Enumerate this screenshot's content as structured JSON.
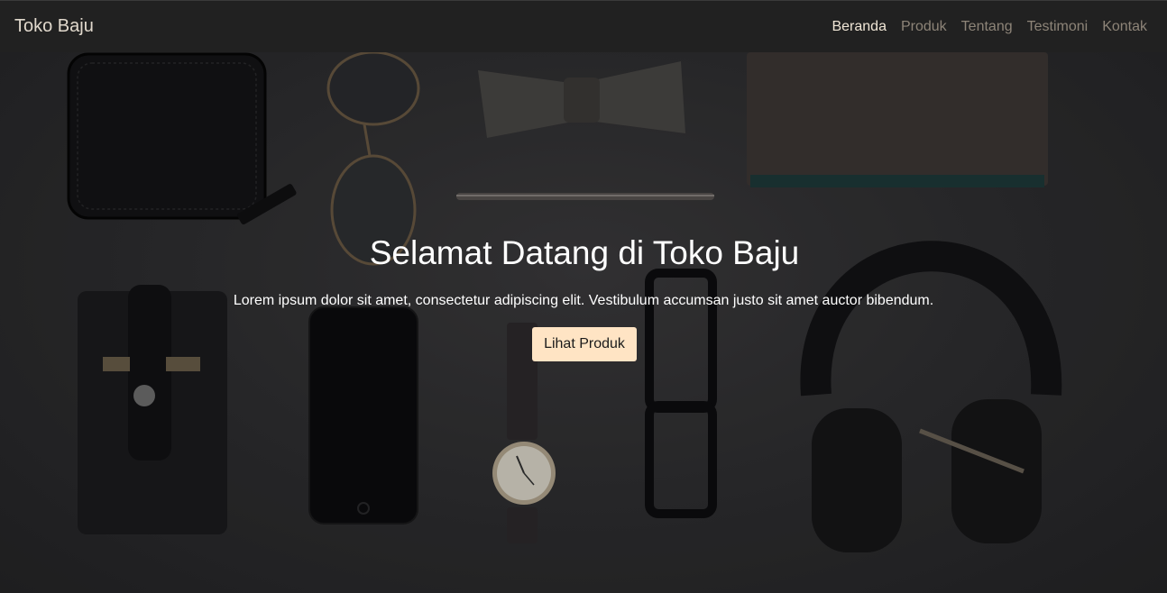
{
  "navbar": {
    "brand": "Toko Baju",
    "links": [
      {
        "label": "Beranda",
        "active": true
      },
      {
        "label": "Produk",
        "active": false
      },
      {
        "label": "Tentang",
        "active": false
      },
      {
        "label": "Testimoni",
        "active": false
      },
      {
        "label": "Kontak",
        "active": false
      }
    ]
  },
  "hero": {
    "title": "Selamat Datang di Toko Baju",
    "subtitle": "Lorem ipsum dolor sit amet, consectetur adipiscing elit. Vestibulum accumsan justo sit amet auctor bibendum.",
    "button_label": "Lihat Produk"
  },
  "colors": {
    "navbar_bg": "#212121",
    "button_bg": "#ffe4c4",
    "active_link": "#f0e6d6",
    "inactive_link": "#8d8478"
  }
}
